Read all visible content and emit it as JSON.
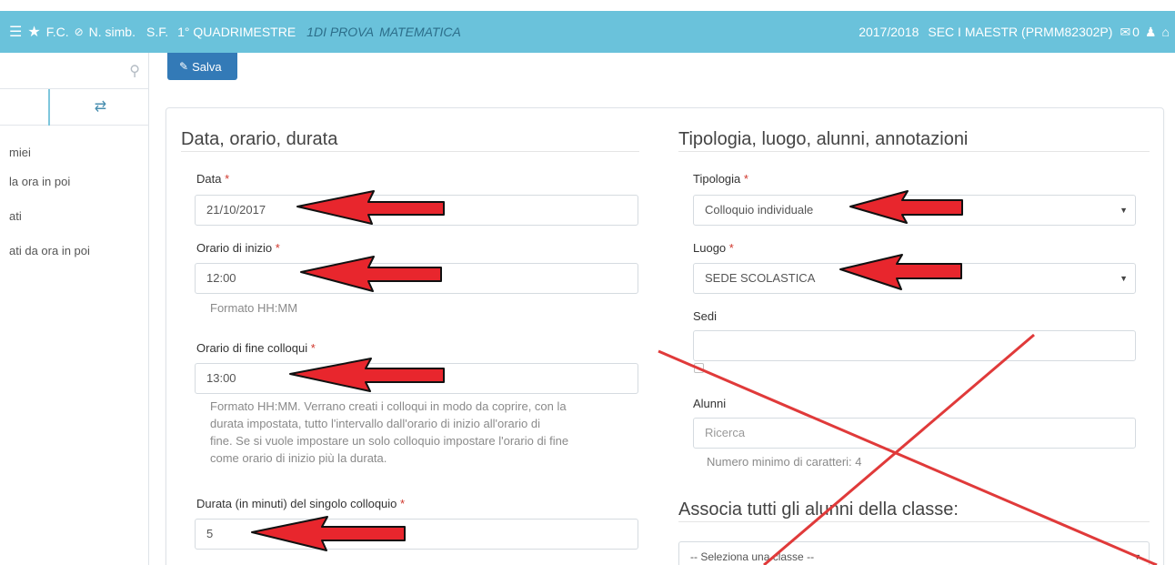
{
  "topbar": {
    "fc": "F.C.",
    "nsimb": "N. simb.",
    "sf": "S.F.",
    "quad": "1° QUADRIMESTRE",
    "class": "1DI PROVA",
    "subject": "MATEMATICA",
    "year": "2017/2018",
    "school": "SEC I MAESTR (PRMM82302P)",
    "mail_count": "0"
  },
  "sidebar": {
    "items": [
      "miei",
      "la ora in poi",
      "ati",
      "ati da ora in poi"
    ]
  },
  "toolbar": {
    "save_label": "Salva"
  },
  "left": {
    "title": "Data, orario, durata",
    "date_label": "Data",
    "date_value": "21/10/2017",
    "start_label": "Orario di inizio",
    "start_value": "12:00",
    "start_help": "Formato HH:MM",
    "end_label": "Orario di fine colloqui",
    "end_value": "13:00",
    "end_help": [
      "Formato HH:MM. Verrano creati i colloqui in modo da coprire, con la",
      "durata impostata, tutto l'intervallo dall'orario di inizio all'orario di",
      "fine. Se si vuole impostare un solo colloquio impostare l'orario di fine",
      "come orario di inizio più la durata."
    ],
    "dur_label": "Durata (in minuti) del singolo colloquio",
    "dur_value": "5"
  },
  "right": {
    "title": "Tipologia, luogo, alunni, annotazioni",
    "tipo_label": "Tipologia",
    "tipo_value": "Colloquio individuale",
    "luogo_label": "Luogo",
    "luogo_value": "SEDE SCOLASTICA",
    "sedi_label": "Sedi",
    "alunni_label": "Alunni",
    "alunni_placeholder": "Ricerca",
    "alunni_help": "Numero minimo di caratteri: 4",
    "assoc_title": "Associa tutti gli alunni della classe:",
    "class_select_value": "-- Seleziona una classe --"
  },
  "annotations": {
    "arrow_color": "#e8262d",
    "cross_color": "#e03a3a"
  }
}
